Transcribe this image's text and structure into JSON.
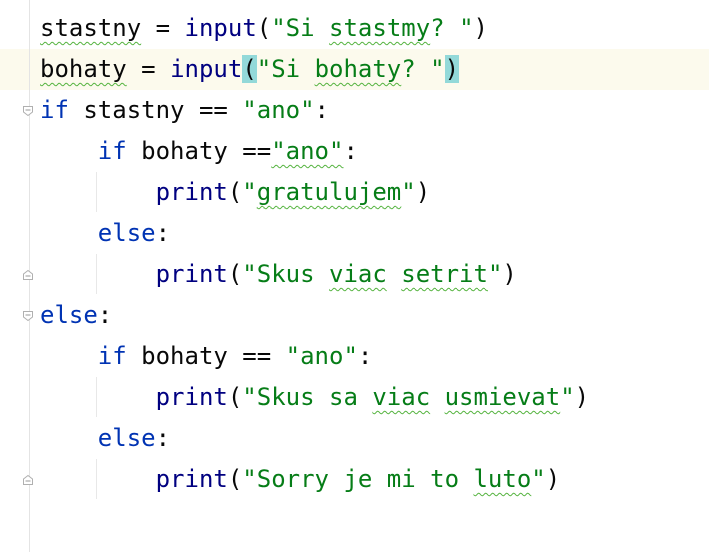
{
  "editor": {
    "language": "python",
    "colors": {
      "keyword": "#0033b3",
      "string": "#067d17",
      "builtin": "#000080",
      "text": "#080808",
      "brace_highlight": "#93d9d9",
      "current_line": "#fcfaed",
      "typo_underline": "#54b33e"
    },
    "lines": [
      {
        "tokens": [
          {
            "t": "stastny",
            "c": "var typo"
          },
          {
            "t": " = ",
            "c": "op"
          },
          {
            "t": "input",
            "c": "fn"
          },
          {
            "t": "(",
            "c": "op"
          },
          {
            "t": "\"Si ",
            "c": "str"
          },
          {
            "t": "stastmy",
            "c": "str typo"
          },
          {
            "t": "? \"",
            "c": "str"
          },
          {
            "t": ")",
            "c": "op"
          }
        ]
      },
      {
        "tokens": [
          {
            "t": "bohaty",
            "c": "var typo"
          },
          {
            "t": " = ",
            "c": "op"
          },
          {
            "t": "input",
            "c": "fn"
          },
          {
            "t": "(",
            "c": "op brace-match"
          },
          {
            "t": "\"Si ",
            "c": "str"
          },
          {
            "t": "bohaty",
            "c": "str typo"
          },
          {
            "t": "? \"",
            "c": "str"
          },
          {
            "t": ")",
            "c": "op brace-match"
          }
        ]
      },
      {
        "tokens": [
          {
            "t": "if",
            "c": "kw"
          },
          {
            "t": " stastny == ",
            "c": "var"
          },
          {
            "t": "\"ano\"",
            "c": "str"
          },
          {
            "t": ":",
            "c": "op"
          }
        ]
      },
      {
        "tokens": [
          {
            "t": "    ",
            "c": "var"
          },
          {
            "t": "if",
            "c": "kw"
          },
          {
            "t": " bohaty ==",
            "c": "var"
          },
          {
            "t": "\"ano\"",
            "c": "str typo"
          },
          {
            "t": ":",
            "c": "op"
          }
        ]
      },
      {
        "tokens": [
          {
            "t": "        ",
            "c": "var"
          },
          {
            "t": "print",
            "c": "fn"
          },
          {
            "t": "(",
            "c": "op"
          },
          {
            "t": "\"",
            "c": "str"
          },
          {
            "t": "gratulujem",
            "c": "str typo"
          },
          {
            "t": "\"",
            "c": "str"
          },
          {
            "t": ")",
            "c": "op"
          }
        ]
      },
      {
        "tokens": [
          {
            "t": "    ",
            "c": "var"
          },
          {
            "t": "else",
            "c": "kw"
          },
          {
            "t": ":",
            "c": "op"
          }
        ]
      },
      {
        "tokens": [
          {
            "t": "        ",
            "c": "var"
          },
          {
            "t": "print",
            "c": "fn"
          },
          {
            "t": "(",
            "c": "op"
          },
          {
            "t": "\"Skus ",
            "c": "str"
          },
          {
            "t": "viac",
            "c": "str typo"
          },
          {
            "t": " ",
            "c": "str"
          },
          {
            "t": "setrit",
            "c": "str typo"
          },
          {
            "t": "\"",
            "c": "str"
          },
          {
            "t": ")",
            "c": "op"
          }
        ]
      },
      {
        "tokens": [
          {
            "t": "else",
            "c": "kw"
          },
          {
            "t": ":",
            "c": "op"
          }
        ]
      },
      {
        "tokens": [
          {
            "t": "    ",
            "c": "var"
          },
          {
            "t": "if",
            "c": "kw"
          },
          {
            "t": " bohaty == ",
            "c": "var"
          },
          {
            "t": "\"ano\"",
            "c": "str"
          },
          {
            "t": ":",
            "c": "op"
          }
        ]
      },
      {
        "tokens": [
          {
            "t": "        ",
            "c": "var"
          },
          {
            "t": "print",
            "c": "fn"
          },
          {
            "t": "(",
            "c": "op"
          },
          {
            "t": "\"Skus sa ",
            "c": "str"
          },
          {
            "t": "viac",
            "c": "str typo"
          },
          {
            "t": " ",
            "c": "str"
          },
          {
            "t": "usmievat",
            "c": "str typo"
          },
          {
            "t": "\"",
            "c": "str"
          },
          {
            "t": ")",
            "c": "op"
          }
        ]
      },
      {
        "tokens": [
          {
            "t": "    ",
            "c": "var"
          },
          {
            "t": "else",
            "c": "kw"
          },
          {
            "t": ":",
            "c": "op"
          }
        ]
      },
      {
        "tokens": [
          {
            "t": "        ",
            "c": "var"
          },
          {
            "t": "print",
            "c": "fn"
          },
          {
            "t": "(",
            "c": "op"
          },
          {
            "t": "\"Sorry je mi to ",
            "c": "str"
          },
          {
            "t": "luto",
            "c": "str typo"
          },
          {
            "t": "\"",
            "c": "str"
          },
          {
            "t": ")",
            "c": "op"
          }
        ]
      }
    ],
    "fold_markers": [
      {
        "line": 2,
        "icon": "fold-open-icon"
      },
      {
        "line": 6,
        "icon": "fold-end-icon"
      },
      {
        "line": 7,
        "icon": "fold-open-icon"
      },
      {
        "line": 11,
        "icon": "fold-end-icon"
      }
    ]
  }
}
